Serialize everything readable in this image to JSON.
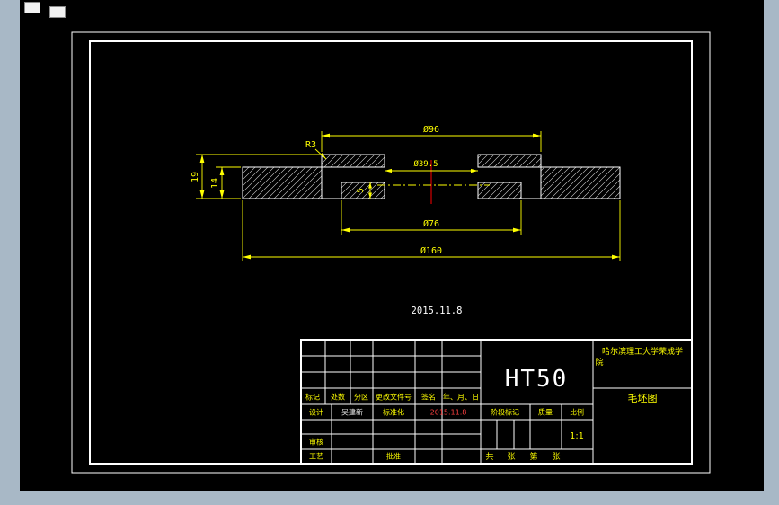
{
  "window": {
    "bg_color": "#a8b8c6",
    "canvas_color": "#000000"
  },
  "drawing": {
    "dims": {
      "d96": "Ø96",
      "d19": "19",
      "d14": "14",
      "r3": "R3",
      "d39_5": "Ø39.5",
      "d5": "5",
      "d76": "Ø76",
      "d160": "Ø160"
    },
    "date_note": "2015.11.8",
    "colors": {
      "dimension": "#ffff00",
      "outline": "#ffffff",
      "centerline_red": "#ff0000"
    }
  },
  "title_block": {
    "material": "HT50",
    "school_line1": "哈尔滨理工大学荣成学",
    "school_line2": "院",
    "drawing_title": "毛坯图",
    "header": {
      "mark": "标记",
      "count": "处数",
      "zone": "分区",
      "doc_no": "更改文件号",
      "sign": "签名",
      "date": "年、月、日"
    },
    "roles": {
      "design": "设计",
      "standardization": "标准化",
      "check": "审核",
      "process": "工艺",
      "approve": "批准"
    },
    "fields": {
      "stage_mark": "阶段标记",
      "weight": "质量",
      "scale": "比例",
      "scale_value": "1:1",
      "total": "共",
      "sheet": "张",
      "no": "第",
      "sheet2": "张"
    },
    "signature": "吴建新",
    "red_date": "2015.11.8"
  }
}
